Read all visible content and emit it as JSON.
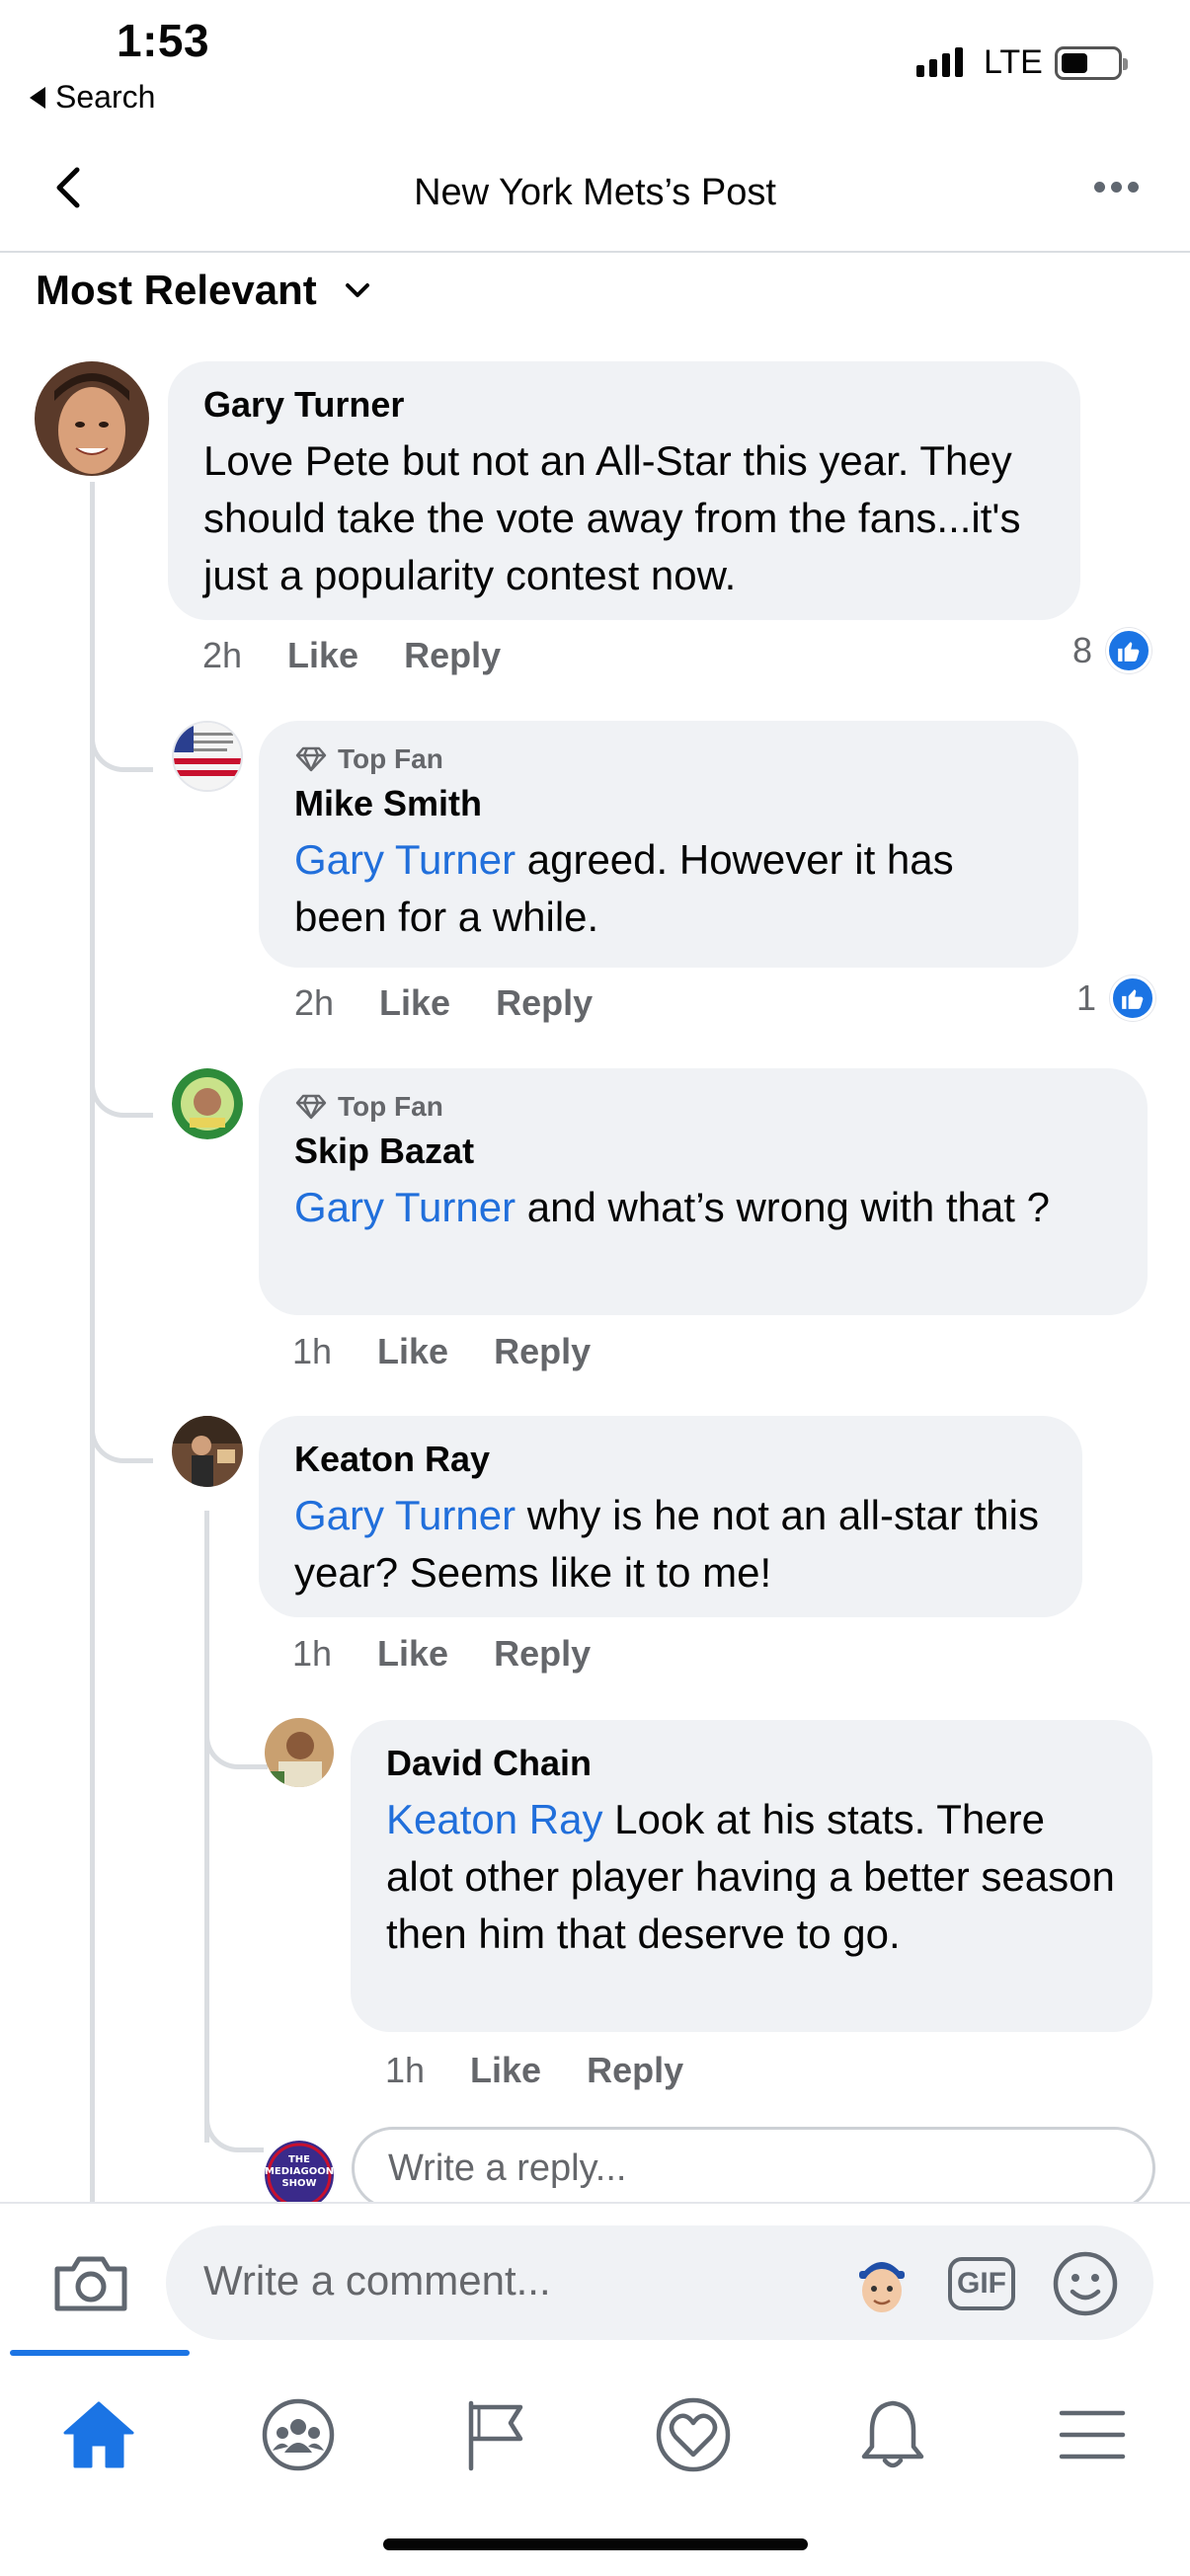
{
  "status_bar": {
    "time": "1:53",
    "back_app": "Search",
    "network": "LTE"
  },
  "header": {
    "title": "New York Mets’s Post"
  },
  "sort": {
    "label": "Most Relevant"
  },
  "comments": [
    {
      "author": "Gary Turner",
      "text": "Love Pete but not an All-Star this year. They should take the vote away from the fans...it's just a popularity contest now.",
      "time": "2h",
      "like": "Like",
      "reply": "Reply",
      "reactions": "8"
    },
    {
      "badge": "Top Fan",
      "author": "Mike Smith",
      "mention": "Gary Turner",
      "text": " agreed.  However it has been for a while.",
      "time": "2h",
      "like": "Like",
      "reply": "Reply",
      "reactions": "1"
    },
    {
      "badge": "Top Fan",
      "author": "Skip Bazat",
      "mention": "Gary Turner",
      "text": " and what’s wrong with that ?",
      "time": "1h",
      "like": "Like",
      "reply": "Reply"
    },
    {
      "author": "Keaton Ray",
      "mention": "Gary Turner",
      "text": " why is he not an all-star this year? Seems like it to me!",
      "time": "1h",
      "like": "Like",
      "reply": "Reply"
    },
    {
      "author": "David Chain",
      "mention": "Keaton Ray",
      "text": " Look at his stats. There alot other player having a better season then him that deserve to go.",
      "time": "1h",
      "like": "Like",
      "reply": "Reply"
    }
  ],
  "reply_input": {
    "placeholder": "Write a reply..."
  },
  "composer": {
    "placeholder": "Write a comment...",
    "gif_label": "GIF"
  },
  "avatar_text": {
    "mediagoon": "THE MEDIAGOON SHOW"
  },
  "colors": {
    "accent": "#1b74e4",
    "mention": "#216fdb",
    "bubble": "#f0f2f5"
  },
  "tabs": [
    "home-icon",
    "groups-icon",
    "pages-flag-icon",
    "dating-heart-icon",
    "notifications-bell-icon",
    "menu-icon"
  ]
}
